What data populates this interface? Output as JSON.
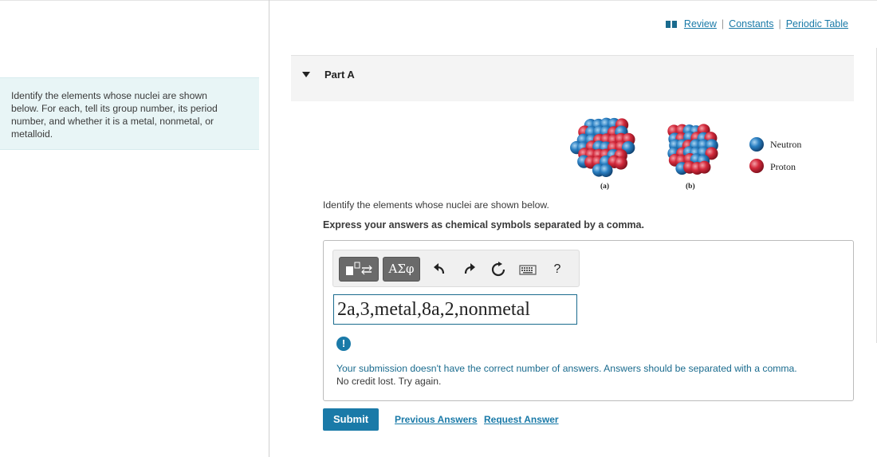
{
  "intro": {
    "text": "Identify the elements whose nuclei are shown below. For each, tell its group number, its period number, and whether it is a metal, nonmetal, or metalloid."
  },
  "toplinks": {
    "review": "Review",
    "constants": "Constants",
    "periodic_table": "Periodic Table",
    "sep": "|"
  },
  "part": {
    "title": "Part A"
  },
  "figure": {
    "label_a": "(a)",
    "label_b": "(b)",
    "legend_neutron": "Neutron",
    "legend_proton": "Proton",
    "neutron_color": "#2a7fc2",
    "proton_color": "#d42a3c"
  },
  "question": {
    "prompt": "Identify the elements whose nuclei are shown below.",
    "instruction": "Express your answers as chemical symbols separated by a comma."
  },
  "toolbar": {
    "templates_icon": "templates-icon",
    "symbols_label": "ΑΣφ",
    "undo_icon": "undo-icon",
    "redo_icon": "redo-icon",
    "reset_icon": "reset-icon",
    "keyboard_icon": "keyboard-icon",
    "help_label": "?"
  },
  "answer": {
    "value": "2a,3,metal,8a,2,nonmetal"
  },
  "feedback": {
    "icon": "!",
    "message": "Your submission doesn't have the correct number of answers. Answers should be separated with a comma.",
    "credit": "No credit lost. Try again."
  },
  "actions": {
    "submit": "Submit",
    "previous_answers": "Previous Answers",
    "request_answer": "Request Answer"
  }
}
